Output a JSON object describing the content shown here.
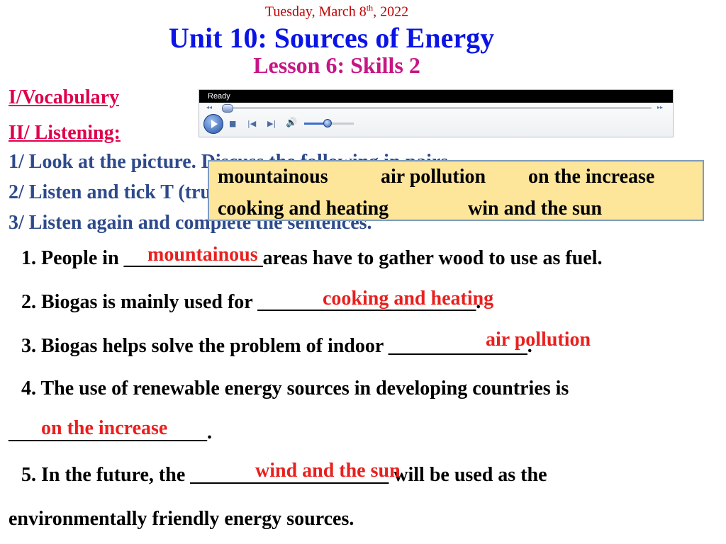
{
  "header": {
    "date_main": "Tuesday, March 8",
    "date_sup": "th",
    "date_year": ", 2022",
    "title": "Unit 10: Sources of Energy",
    "subtitle": "Lesson 6: Skills 2"
  },
  "sections": {
    "vocabulary": "I/Vocabulary",
    "listening": "II/ Listening:"
  },
  "tasks": {
    "t1": "1/ Look at the picture. Discuss the following in pairs.",
    "t2": "2/ Listen and tick T (true) or F (false).",
    "t3": "3/ Listen again and complete the sentences."
  },
  "player": {
    "status": "Ready"
  },
  "word_box": {
    "w1": "mountainous",
    "w2": "air pollution",
    "w3": "on the increase",
    "w4": "cooking and heating",
    "w5": "win and the sun"
  },
  "sentences": {
    "s1_prefix": "1. People in ______________areas have to gather wood to use as fuel.",
    "s1_answer": "mountainous",
    "s2_prefix": "2. Biogas is mainly used for ______________________.",
    "s2_answer": "cooking and heating",
    "s3_prefix": "3. Biogas helps solve the problem of indoor ______________.",
    "s3_answer": "air pollution",
    "s4_line1": "4. The use of renewable energy sources in developing countries is",
    "s4_line2": "____________________.",
    "s4_answer": "on the increase",
    "s5_line1": "5. In the future, the ____________________ will be used as the",
    "s5_answer": "wind and the sun",
    "s5_line2": "environmentally friendly energy sources."
  },
  "colors": {
    "date": "#c00000",
    "title": "#0a14e6",
    "subtitle": "#c71585",
    "section": "#e0004a",
    "task": "#2e4a8c",
    "answer": "#e8201e",
    "wordbox_bg": "#fde59a"
  },
  "icons": [
    "play-icon",
    "stop-icon",
    "previous-icon",
    "next-icon",
    "volume-icon"
  ],
  "volume_level": 0.45,
  "seek_progress": 0.0
}
